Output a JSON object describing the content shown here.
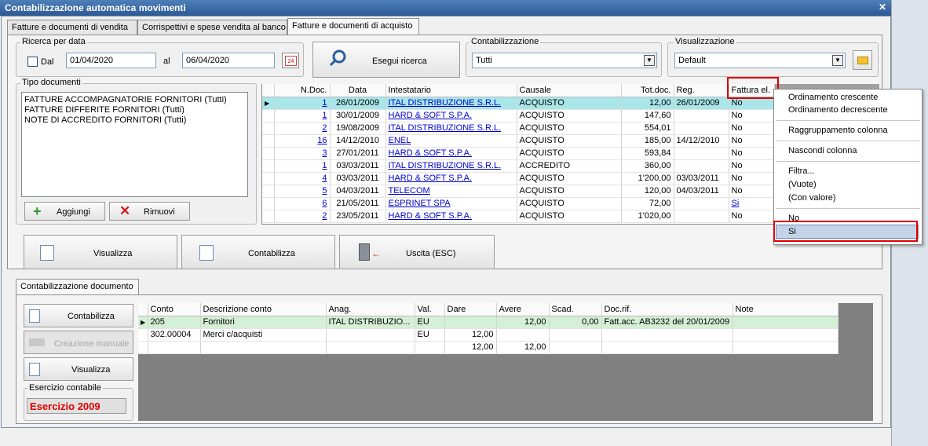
{
  "window": {
    "title": "Contabilizzazione automatica movimenti"
  },
  "tabs": [
    "Fatture e documenti di vendita",
    "Corrispettivi e spese vendita al banco",
    "Fatture e documenti di acquisto"
  ],
  "search": {
    "group_label": "Ricerca per data",
    "dal_label": "Dal",
    "al_label": "al",
    "from_date": "01/04/2020",
    "to_date": "06/04/2020",
    "calendar_day": "24",
    "button": "Esegui ricerca"
  },
  "contabilizzazione": {
    "label": "Contabilizzazione",
    "value": "Tutti"
  },
  "visualizzazione": {
    "label": "Visualizzazione",
    "value": "Default"
  },
  "tipo_documenti": {
    "label": "Tipo documenti",
    "items": [
      "FATTURE ACCOMPAGNATORIE FORNITORI (Tutti)",
      "FATTURE DIFFERITE FORNITORI (Tutti)",
      "NOTE DI ACCREDITO FORNITORI (Tutti)"
    ],
    "add": "Aggiungi",
    "remove": "Rimuovi"
  },
  "grid": {
    "headers": [
      "N.Doc.",
      "Data",
      "Intestatario",
      "Causale",
      "Tot.doc.",
      "Reg.",
      "Fattura el."
    ],
    "rows": [
      [
        "1",
        "26/01/2009",
        "ITAL DISTRIBUZIONE S.R.L.",
        "ACQUISTO",
        "12,00",
        "26/01/2009",
        "No"
      ],
      [
        "1",
        "30/01/2009",
        "HARD & SOFT S.P.A.",
        "ACQUISTO",
        "147,60",
        "",
        "No"
      ],
      [
        "2",
        "19/08/2009",
        "ITAL DISTRIBUZIONE S.R.L.",
        "ACQUISTO",
        "554,01",
        "",
        "No"
      ],
      [
        "16",
        "14/12/2010",
        "ENEL",
        "ACQUISTO",
        "185,00",
        "14/12/2010",
        "No"
      ],
      [
        "3",
        "27/01/2011",
        "HARD & SOFT S.P.A.",
        "ACQUISTO",
        "593,84",
        "",
        "No"
      ],
      [
        "1",
        "03/03/2011",
        "ITAL DISTRIBUZIONE S.R.L.",
        "ACCREDITO",
        "360,00",
        "",
        "No"
      ],
      [
        "4",
        "03/03/2011",
        "HARD & SOFT S.P.A.",
        "ACQUISTO",
        "1'200,00",
        "03/03/2011",
        "No"
      ],
      [
        "5",
        "04/03/2011",
        "TELECOM",
        "ACQUISTO",
        "120,00",
        "04/03/2011",
        "No"
      ],
      [
        "6",
        "21/05/2011",
        "ESPRINET SPA",
        "ACQUISTO",
        "72,00",
        "",
        "Si"
      ],
      [
        "2",
        "23/05/2011",
        "HARD & SOFT S.P.A.",
        "ACQUISTO",
        "1'020,00",
        "",
        "No"
      ]
    ]
  },
  "context_menu": {
    "items": [
      "Ordinamento crescente",
      "Ordinamento decrescente",
      "Raggruppamento colonna",
      "Nascondi colonna",
      "Filtra...",
      "(Vuote)",
      "(Con valore)",
      "No",
      "Si"
    ]
  },
  "actions": {
    "visualizza": "Visualizza",
    "contabilizza": "Contabilizza",
    "uscita": "Uscita (ESC)"
  },
  "doc": {
    "tab": "Contabilizzazione documento",
    "contabilizza": "Contabilizza",
    "creazione": "Creazione manuale",
    "visualizza": "Visualizza",
    "esercizio_label": "Esercizio contabile",
    "esercizio_value": "Esercizio 2009",
    "headers": [
      "Conto",
      "Descrizione conto",
      "Anag.",
      "Val.",
      "Dare",
      "Avere",
      "Scad.",
      "Doc.rif.",
      "Note"
    ],
    "rows": [
      [
        "205",
        "Fornitori",
        "ITAL DISTRIBUZIO...",
        "EU",
        "",
        "12,00",
        "0,00",
        "Fatt.acc. AB3232 del 20/01/2009",
        ""
      ],
      [
        "302.00004",
        "Merci c/acquisti",
        "",
        "EU",
        "12,00",
        "",
        "",
        "",
        ""
      ],
      [
        "",
        "",
        "",
        "",
        "12,00",
        "12,00",
        "",
        "",
        ""
      ]
    ]
  },
  "colors": {
    "title_bar": "#3a6aa8",
    "selected_row": "#a8e6ea",
    "doc_selected_row": "#d4f0d4",
    "highlight_red": "#e00000",
    "esercizio_text": "#e00000"
  }
}
